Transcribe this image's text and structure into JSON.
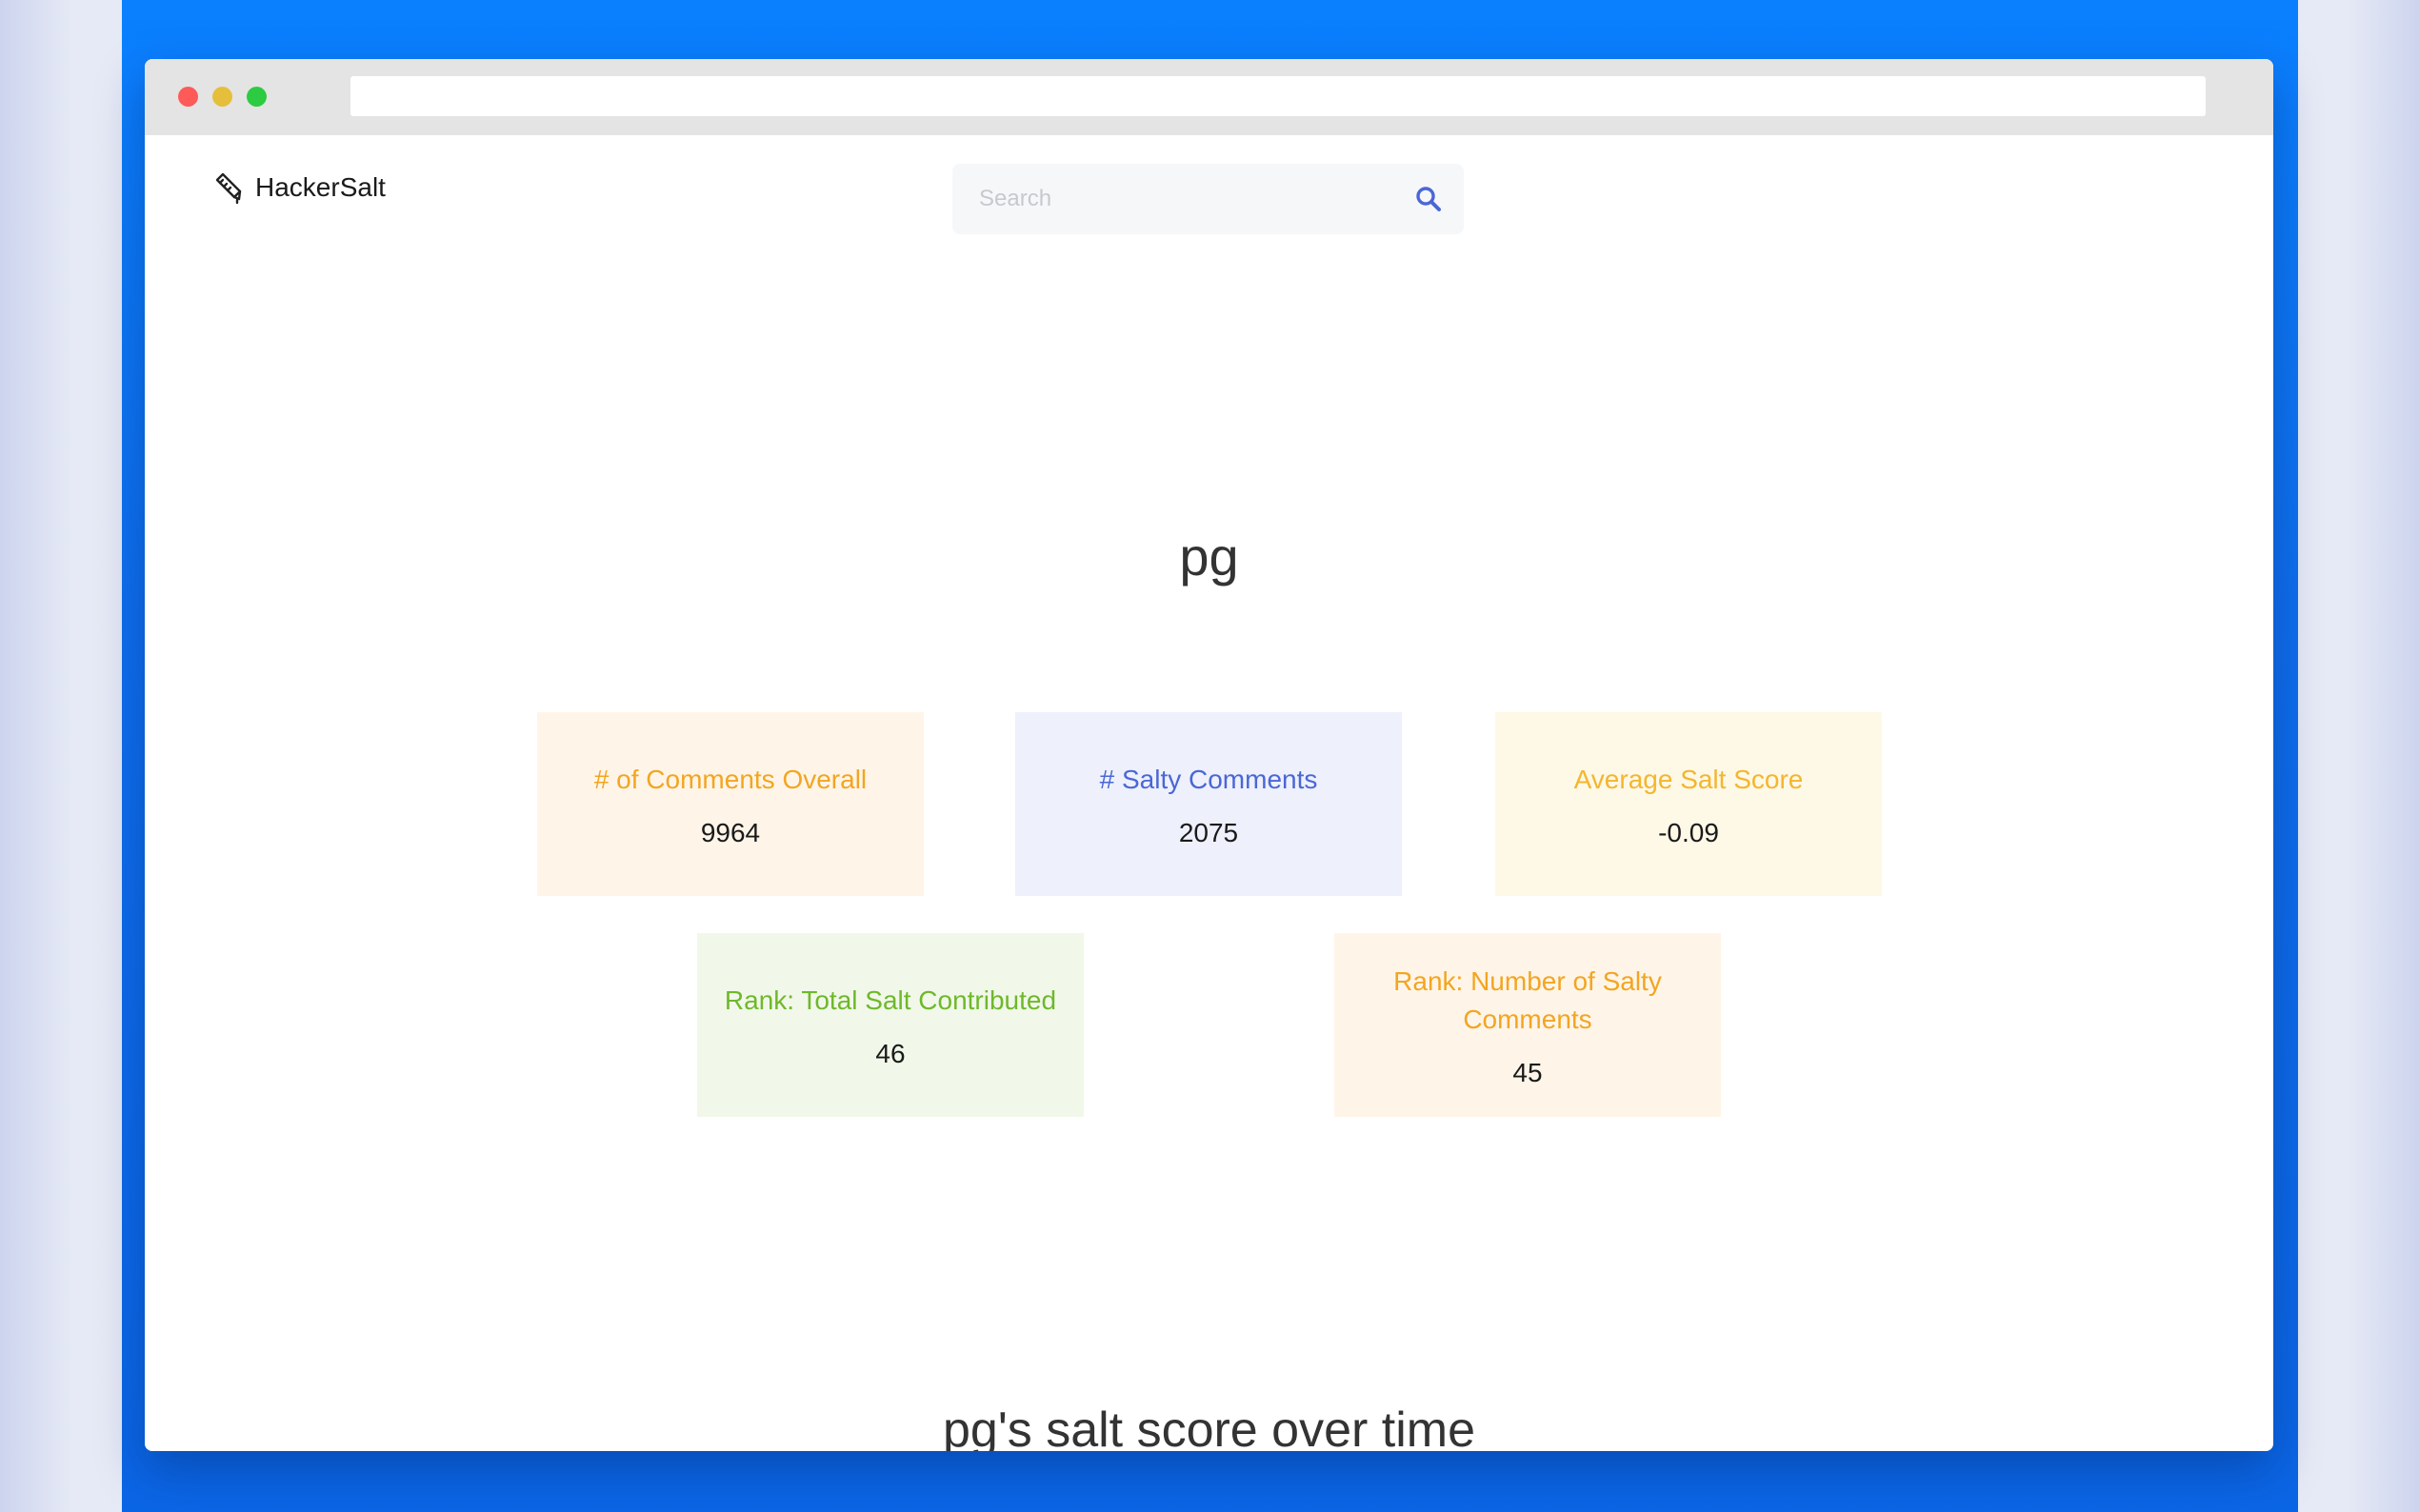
{
  "browser": {
    "url": ""
  },
  "header": {
    "brand": "HackerSalt",
    "logo_icon": "pencil-ruler-icon",
    "search_placeholder": "Search",
    "search_value": "",
    "search_icon": "search-icon",
    "accent_color": "#4a67d6"
  },
  "profile": {
    "username": "pg"
  },
  "stats": [
    {
      "label": "# of Comments Overall",
      "value": "9964",
      "color": "#f3a521",
      "bg": "#fef5e8"
    },
    {
      "label": "# Salty Comments",
      "value": "2075",
      "color": "#4a67d6",
      "bg": "#eef0fb"
    },
    {
      "label": "Average Salt Score",
      "value": "-0.09",
      "color": "#f4b62e",
      "bg": "#fef8e7"
    },
    {
      "label": "Rank: Total Salt Contributed",
      "value": "46",
      "color": "#6fb82a",
      "bg": "#f1f8ea"
    },
    {
      "label": "Rank: Number of Salty Comments",
      "value": "45",
      "color": "#f3a521",
      "bg": "#fef5e8"
    }
  ],
  "chart_section": {
    "title": "pg's salt score over time"
  }
}
